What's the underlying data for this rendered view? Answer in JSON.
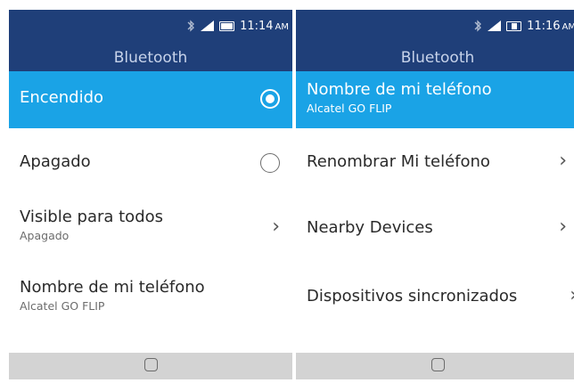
{
  "left_screen": {
    "status": {
      "time": "11:14",
      "ampm": "AM",
      "bluetooth_icon": "bluetooth-icon",
      "signal_icon": "signal-icon",
      "battery_icon": "battery-icon"
    },
    "title": "Bluetooth",
    "items": [
      {
        "label": "Encendido",
        "selected": true,
        "control": "radio-on"
      },
      {
        "label": "Apagado",
        "control": "radio-off"
      },
      {
        "label": "Visible para todos",
        "sub": "Apagado",
        "control": "chevron"
      },
      {
        "label": "Nombre de mi teléfono",
        "sub": "Alcatel GO FLIP"
      }
    ]
  },
  "right_screen": {
    "status": {
      "time": "11:16",
      "ampm": "AM",
      "bluetooth_icon": "bluetooth-icon",
      "signal_icon": "signal-icon",
      "battery_icon": "battery-charging-icon"
    },
    "title": "Bluetooth",
    "items": [
      {
        "label": "Nombre de mi teléfono",
        "sub": "Alcatel GO FLIP",
        "selected": true
      },
      {
        "label": "Renombrar Mi teléfono",
        "control": "chevron"
      },
      {
        "label": "Nearby Devices",
        "control": "chevron"
      },
      {
        "label": "Dispositivos sincronizados",
        "control": "chevron"
      }
    ]
  },
  "chevron_glyph": "›",
  "colors": {
    "header": "#1f3f79",
    "selected": "#1aa3e6",
    "footer": "#d3d3d3"
  }
}
